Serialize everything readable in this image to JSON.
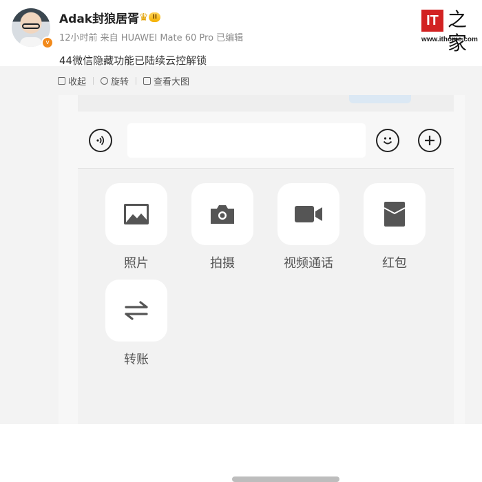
{
  "post": {
    "username": "Adak封狼居胥",
    "vip_level": "II",
    "meta": "12小时前 来自 HUAWEI Mate 60 Pro 已编辑",
    "text": "44微信隐藏功能已陆续云控解锁",
    "avatar_badge": "v"
  },
  "logo": {
    "mark": "IT",
    "hand": "之家",
    "url": "www.ithome.com"
  },
  "toolbar": {
    "items": [
      {
        "label": "收起",
        "icon": "collapse-icon"
      },
      {
        "label": "旋转",
        "icon": "rotate-icon"
      },
      {
        "label": "查看大图",
        "icon": "view-large-icon"
      }
    ]
  },
  "chat": {
    "actions": [
      {
        "label": "照片",
        "icon": "image-icon"
      },
      {
        "label": "拍摄",
        "icon": "camera-icon"
      },
      {
        "label": "视频通话",
        "icon": "video-call-icon"
      },
      {
        "label": "红包",
        "icon": "red-packet-icon"
      },
      {
        "label": "转账",
        "icon": "transfer-icon"
      }
    ]
  },
  "colors": {
    "accent_red": "#d22222",
    "badge_orange": "#f28a1c",
    "icon_dark": "#555555"
  }
}
